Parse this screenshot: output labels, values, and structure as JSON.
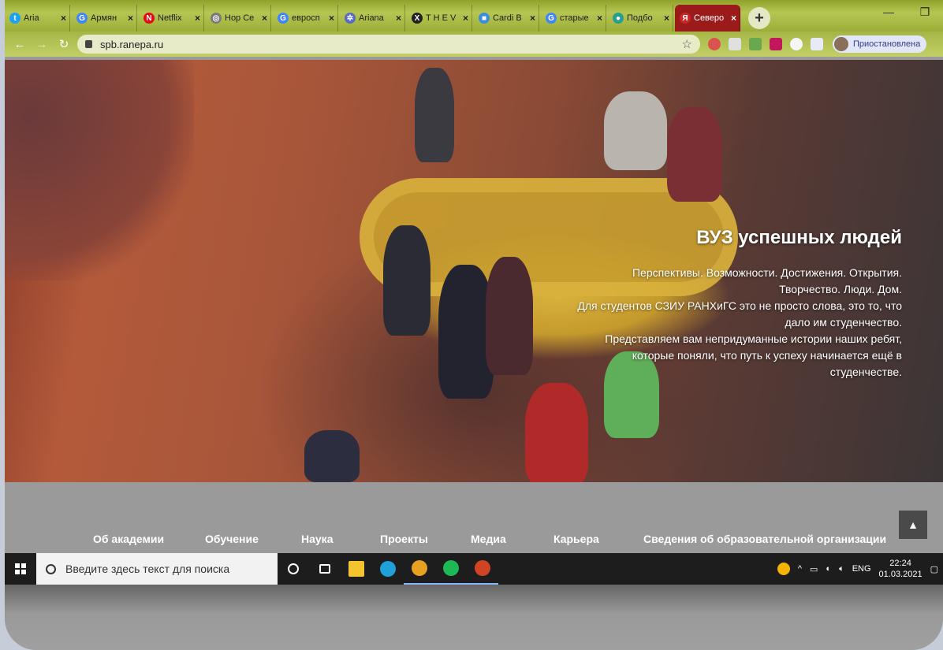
{
  "browser": {
    "tabs": [
      {
        "title": "Aria",
        "icon": "twitter-icon",
        "color": "#1da1f2",
        "glyph": "t"
      },
      {
        "title": "Армян",
        "icon": "google-icon",
        "color": "#4285f4",
        "glyph": "G"
      },
      {
        "title": "Netflix",
        "icon": "netflix-icon",
        "color": "#e50914",
        "glyph": "N"
      },
      {
        "title": "Hop Ce",
        "icon": "globe-icon",
        "color": "#7a7a7a",
        "glyph": "◎"
      },
      {
        "title": "евросп",
        "icon": "google-icon",
        "color": "#4285f4",
        "glyph": "G"
      },
      {
        "title": "Ariana",
        "icon": "star-icon",
        "color": "#5a6abf",
        "glyph": "✲"
      },
      {
        "title": "T H E V",
        "icon": "xo-icon",
        "color": "#222222",
        "glyph": "X"
      },
      {
        "title": "Cardi B",
        "icon": "page-icon",
        "color": "#3a8dde",
        "glyph": "■"
      },
      {
        "title": "старые",
        "icon": "google-icon",
        "color": "#4285f4",
        "glyph": "G"
      },
      {
        "title": "Подбо",
        "icon": "site-icon",
        "color": "#2a9d8f",
        "glyph": "●"
      },
      {
        "title": "Северо",
        "icon": "ranepa-icon",
        "color": "#c62828",
        "glyph": "Я",
        "active": true
      }
    ],
    "new_tab": "+",
    "address": "spb.ranepa.ru",
    "profile_label": "Приостановлена"
  },
  "hero": {
    "title": "ВУЗ успешных людей",
    "lines": [
      "Перспективы. Возможности. Достижения. Открытия.",
      "Творчество. Люди. Дом.",
      "Для студентов СЗИУ РАНХиГС это не просто слова, это то, что",
      "дало им студенчество.",
      "Представляем вам непридуманные истории наших ребят,",
      "которые поняли, что путь к успеху начинается ещё в",
      "студенчестве."
    ]
  },
  "site_nav": {
    "items": [
      "Об академии",
      "Обучение",
      "Наука",
      "Проекты",
      "Медиа",
      "Карьера",
      "Сведения об образовательной организации"
    ],
    "scroll_top": "▲"
  },
  "taskbar": {
    "search_placeholder": "Введите здесь текст для поиска",
    "apps": [
      {
        "name": "cortana-icon",
        "color": "#ffffff",
        "running": false
      },
      {
        "name": "task-view-icon",
        "color": "#ffffff",
        "running": false
      },
      {
        "name": "file-explorer-icon",
        "color": "#f4c430",
        "running": false
      },
      {
        "name": "edge-icon",
        "color": "#1fa0d8",
        "running": false
      },
      {
        "name": "chrome-icon",
        "color": "#e8a020",
        "running": true
      },
      {
        "name": "spotify-icon",
        "color": "#1db954",
        "running": true
      },
      {
        "name": "powerpoint-icon",
        "color": "#d04423",
        "running": true
      }
    ],
    "language": "ENG",
    "time": "22:24",
    "date": "01.03.2021"
  }
}
